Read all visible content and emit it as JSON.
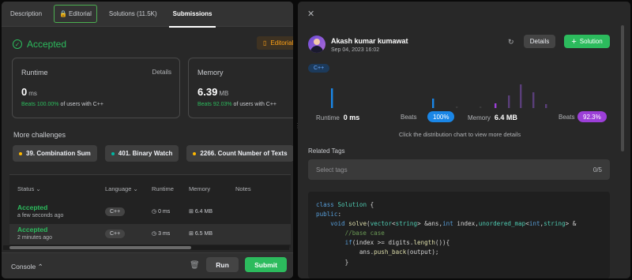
{
  "tabs": [
    {
      "label": "Description"
    },
    {
      "label": "Editorial"
    },
    {
      "label": "Solutions (11.5K)"
    },
    {
      "label": "Submissions"
    }
  ],
  "result": {
    "status": "Accepted",
    "editorial_button": "Editorial"
  },
  "runtime": {
    "label": "Runtime",
    "details": "Details",
    "value": "0",
    "unit": "ms",
    "beats_pct": "Beats 100.00%",
    "beats_rest": "of users with C++"
  },
  "memory": {
    "label": "Memory",
    "value": "6.39",
    "unit": "MB",
    "beats_pct": "Beats 92.03%",
    "beats_rest": "of users with C++"
  },
  "more_challenges": {
    "title": "More challenges",
    "items": [
      {
        "label": "39. Combination Sum",
        "color": "#ffb800"
      },
      {
        "label": "401. Binary Watch",
        "color": "#00b8a3"
      },
      {
        "label": "2266. Count Number of Texts",
        "color": "#ffb800"
      }
    ]
  },
  "submissions": {
    "headers": {
      "status": "Status",
      "language": "Language",
      "runtime": "Runtime",
      "memory": "Memory",
      "notes": "Notes"
    },
    "rows": [
      {
        "status": "Accepted",
        "time": "a few seconds ago",
        "language": "C++",
        "runtime": "0 ms",
        "memory": "6.4 MB"
      },
      {
        "status": "Accepted",
        "time": "2 minutes ago",
        "language": "C++",
        "runtime": "3 ms",
        "memory": "6.5 MB"
      }
    ]
  },
  "bottom": {
    "console": "Console",
    "run": "Run",
    "submit": "Submit"
  },
  "detail": {
    "user": "Akash kumar kumawat",
    "date": "Sep 04, 2023 16:02",
    "details_button": "Details",
    "solution_button": "Solution",
    "language_tag": "C++",
    "runtime_label": "Runtime",
    "runtime_value": "0 ms",
    "runtime_beats_label": "Beats",
    "runtime_beats": "100%",
    "memory_label": "Memory",
    "memory_value": "6.4 MB",
    "memory_beats_label": "Beats",
    "memory_beats": "92.3%",
    "hint": "Click the distribution chart to view more details",
    "related_tags": "Related Tags",
    "tags_placeholder": "Select tags",
    "tags_count": "0/5"
  },
  "colors": {
    "accent": "#2cbb5d",
    "runtime_pill": "#1a86e6",
    "memory_pill": "#9c3fd8"
  },
  "code_lines": [
    "class Solution {",
    "public:",
    "    void solve(vector<string> &ans,int index,unordered_map<int,string> &",
    "        //base case",
    "        if(index >= digits.length()){",
    "            ans.push_back(output);",
    "        }"
  ]
}
